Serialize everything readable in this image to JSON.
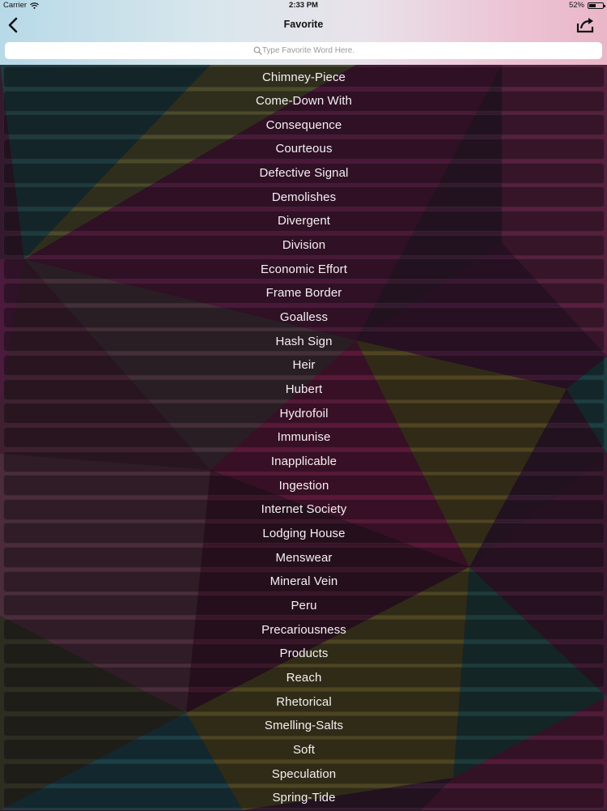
{
  "status_bar": {
    "carrier": "Carrier",
    "time": "2:33 PM",
    "battery": "52%",
    "battery_level": 0.52,
    "wifi_icon": "wifi-icon",
    "battery_icon": "battery-icon"
  },
  "nav": {
    "title": "Favorite",
    "back_icon": "chevron-left-icon",
    "share_icon": "share-icon"
  },
  "search": {
    "placeholder": "Type Favorite Word Here.",
    "value": "",
    "icon": "search-icon"
  },
  "words": [
    "Chimney-Piece",
    "Come-Down With",
    "Consequence",
    "Courteous",
    "Defective Signal",
    "Demolishes",
    "Divergent",
    "Division",
    "Economic Effort",
    "Frame Border",
    "Goalless",
    "Hash Sign",
    "Heir",
    "Hubert",
    "Hydrofoil",
    "Immunise",
    "Inapplicable",
    "Ingestion",
    "Internet Society",
    "Lodging House",
    "Menswear",
    "Mineral Vein",
    "Peru",
    "Precariousness",
    "Products",
    "Reach",
    "Rhetorical",
    "Smelling-Salts",
    "Soft",
    "Speculation",
    "Spring-Tide"
  ],
  "colors": {
    "header_gradient": [
      "#b7d9e8",
      "#e9e2ea",
      "#eab6c8"
    ],
    "row_overlay": "rgba(10,8,12,0.42)",
    "background_palette": [
      "#3b1430",
      "#4a1a3a",
      "#2c2a1e",
      "#1f3a3c",
      "#5a1a36",
      "#3a3a20"
    ]
  }
}
